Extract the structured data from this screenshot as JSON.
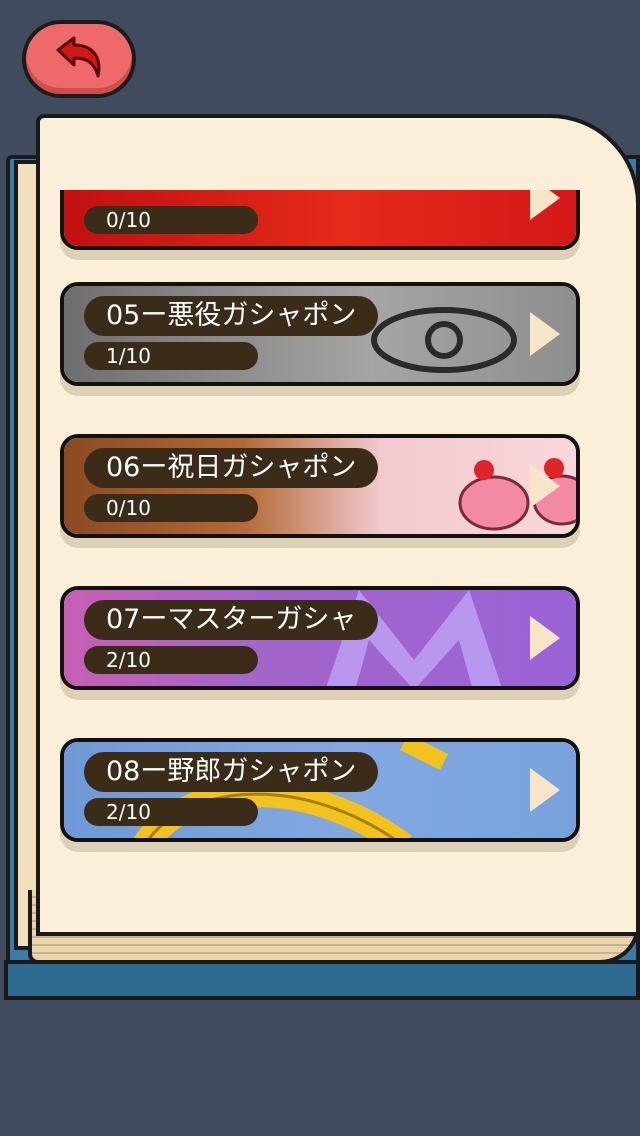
{
  "header": {
    "back_button": "back-arrow-icon"
  },
  "gacha_list": [
    {
      "title": "",
      "progress": "0/10",
      "theme": "red"
    },
    {
      "title": "05ー悪役ガシャポン",
      "progress": "1/10",
      "theme": "gray"
    },
    {
      "title": "06ー祝日ガシャポン",
      "progress": "0/10",
      "theme": "candy"
    },
    {
      "title": "07ーマスターガシャ",
      "progress": "2/10",
      "theme": "purple"
    },
    {
      "title": "08ー野郎ガシャポン",
      "progress": "2/10",
      "theme": "blue"
    }
  ],
  "colors": {
    "background": "#404c5e",
    "back_button": "#ee6a6a",
    "book_cover": "#3b7ca6",
    "page": "#fbefd9",
    "label_bg": "#3b2b19"
  }
}
